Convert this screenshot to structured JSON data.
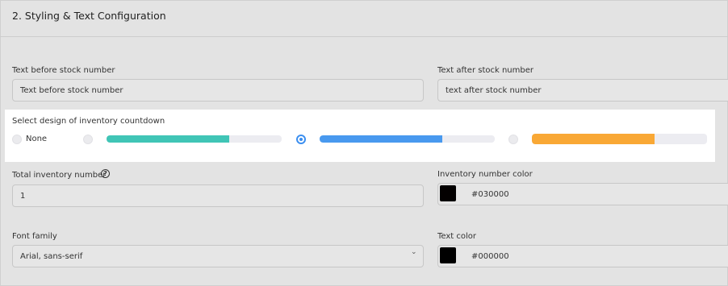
{
  "section": {
    "title": "2. Styling & Text Configuration"
  },
  "text_before": {
    "label": "Text before stock number",
    "value": "Text before stock number"
  },
  "text_after": {
    "label": "Text after stock number",
    "value": "text after stock number"
  },
  "design": {
    "label": "Select design of inventory countdown",
    "none_label": "None",
    "options": [
      {
        "name": "teal",
        "color": "#40c5b6",
        "fill_fraction": 0.7,
        "selected": false
      },
      {
        "name": "blue",
        "color": "#4899ef",
        "fill_fraction": 0.7,
        "selected": true
      },
      {
        "name": "orange",
        "color": "#f9a835",
        "fill_fraction": 0.7,
        "selected": false
      }
    ]
  },
  "total_inventory": {
    "label": "Total inventory number",
    "value": "1",
    "help_glyph": "?"
  },
  "inventory_color": {
    "label": "Inventory number color",
    "value": "#030000",
    "swatch": "#030000"
  },
  "font_family": {
    "label": "Font family",
    "value": "Arial, sans-serif",
    "chevron": "⌄"
  },
  "text_color": {
    "label": "Text color",
    "value": "#000000",
    "swatch": "#000000"
  }
}
